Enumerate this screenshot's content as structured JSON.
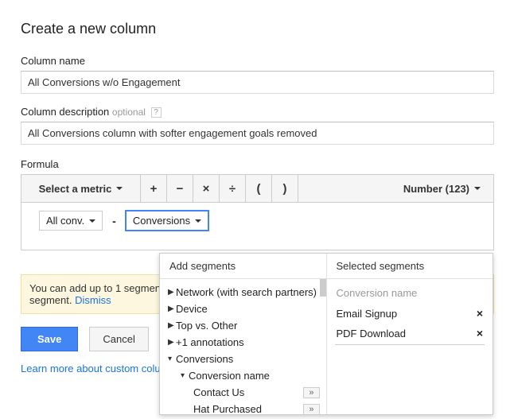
{
  "title": "Create a new column",
  "labels": {
    "column_name": "Column name",
    "column_description": "Column description",
    "optional": "optional",
    "formula": "Formula"
  },
  "fields": {
    "column_name_value": "All Conversions w/o Engagement",
    "column_description_value": "All Conversions column with softer engagement goals removed"
  },
  "toolbar": {
    "select_metric": "Select a metric",
    "op_plus": "+",
    "op_minus": "−",
    "op_times": "×",
    "op_divide": "÷",
    "op_lparen": "(",
    "op_rparen": ")",
    "format": "Number (123)"
  },
  "formula": {
    "chip1": "All conv.",
    "op": "-",
    "chip2": "Conversions"
  },
  "hint": {
    "text": "You can add up to 1 segment to each metric in the formula. Click on one of your metrics to select a segment.",
    "dismiss": "Dismiss"
  },
  "buttons": {
    "save": "Save",
    "cancel": "Cancel"
  },
  "learn_more": "Learn more about custom columns",
  "popover": {
    "add_header": "Add segments",
    "selected_header": "Selected segments",
    "tree": {
      "network": "Network (with search partners)",
      "device": "Device",
      "top_vs_other": "Top vs. Other",
      "plus1": "+1 annotations",
      "conversions": "Conversions",
      "conversion_name": "Conversion name",
      "contact_us": "Contact Us",
      "hat_purchased": "Hat Purchased"
    },
    "selected_label": "Conversion name",
    "selected_items": [
      "Email Signup",
      "PDF Download"
    ],
    "add_glyph": "»",
    "remove_glyph": "×"
  }
}
